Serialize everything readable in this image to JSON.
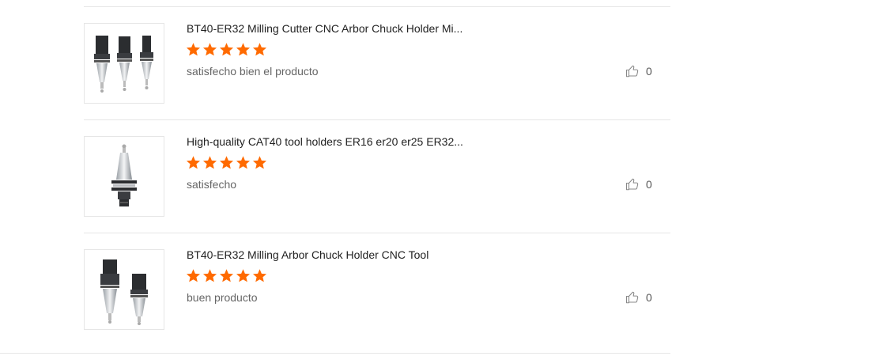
{
  "reviews": [
    {
      "product_title": "BT40-ER32 Milling Cutter CNC Arbor Chuck Holder Mi...",
      "rating": 5,
      "comment": "satisfecho bien el producto",
      "likes": "0",
      "image_icon": "three-tool-holders"
    },
    {
      "product_title": "High-quality CAT40 tool holders ER16 er20 er25 ER32...",
      "rating": 5,
      "comment": "satisfecho",
      "likes": "0",
      "image_icon": "single-tool-holder"
    },
    {
      "product_title": "BT40-ER32 Milling Arbor Chuck Holder CNC Tool",
      "rating": 5,
      "comment": "buen producto",
      "likes": "0",
      "image_icon": "two-tool-holders"
    }
  ],
  "colors": {
    "star": "#ff6a00",
    "divider": "#e6e6e6",
    "title": "#222222",
    "comment": "#666666"
  }
}
